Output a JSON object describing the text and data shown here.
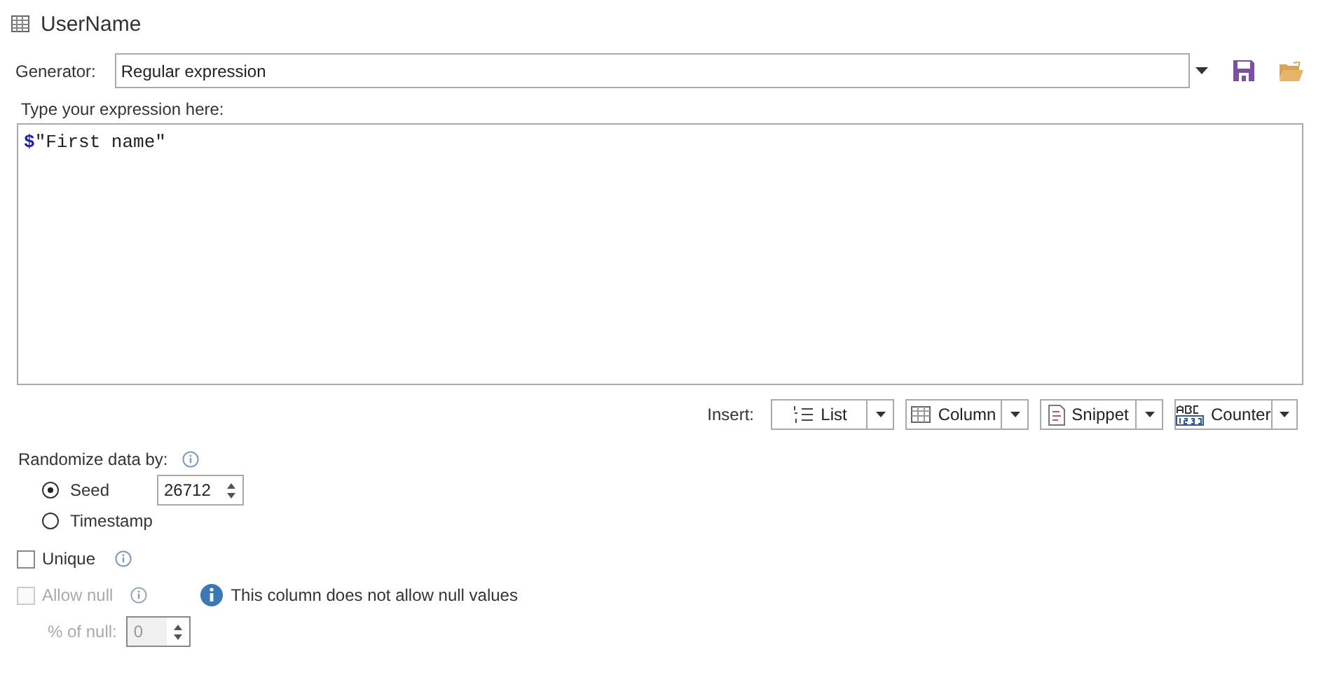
{
  "title": "UserName",
  "generator": {
    "label": "Generator:",
    "value": "Regular expression"
  },
  "expression": {
    "label": "Type your expression here:",
    "value": "**$**\"First name\""
  },
  "insert": {
    "label": "Insert:",
    "buttons": [
      {
        "label": "List",
        "kind": "list"
      },
      {
        "label": "Column",
        "kind": "column"
      },
      {
        "label": "Snippet",
        "kind": "snippet"
      },
      {
        "label": "Counter",
        "kind": "counter"
      }
    ]
  },
  "randomize": {
    "label": "Randomize data by:",
    "options": [
      {
        "label": "Seed",
        "selected": true,
        "value": "26712"
      },
      {
        "label": "Timestamp",
        "selected": false
      }
    ]
  },
  "unique": {
    "label": "Unique",
    "checked": false,
    "disabled": false
  },
  "allow_null": {
    "label": "Allow null",
    "checked": false,
    "disabled": true,
    "message": "This column does not allow null values"
  },
  "null_percent": {
    "label": "% of null:",
    "value": "0",
    "disabled": true
  }
}
